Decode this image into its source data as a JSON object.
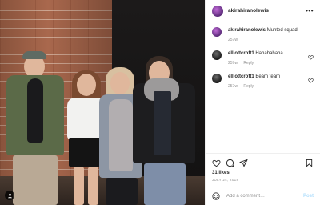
{
  "post": {
    "author": "akirahiranolewis",
    "more_icon": "more-horizontal-icon",
    "caption": "Munted squad",
    "caption_age": "257w",
    "likes": "31 likes",
    "date": "JULY 24, 2018"
  },
  "comments": [
    {
      "user": "elliottcroft1",
      "text": "Hahahahaha",
      "age": "257w",
      "reply_label": "Reply"
    },
    {
      "user": "elliottcroft1",
      "text": "Beam team",
      "age": "257w",
      "reply_label": "Reply"
    }
  ],
  "actions": {
    "icons": [
      "heart-icon",
      "comment-icon",
      "share-icon",
      "bookmark-icon"
    ]
  },
  "add_comment": {
    "placeholder": "Add a comment…",
    "post_label": "Post"
  },
  "colors": {
    "link_disabled": "#b2dffc",
    "muted": "#8e8e8e",
    "text": "#262626"
  }
}
